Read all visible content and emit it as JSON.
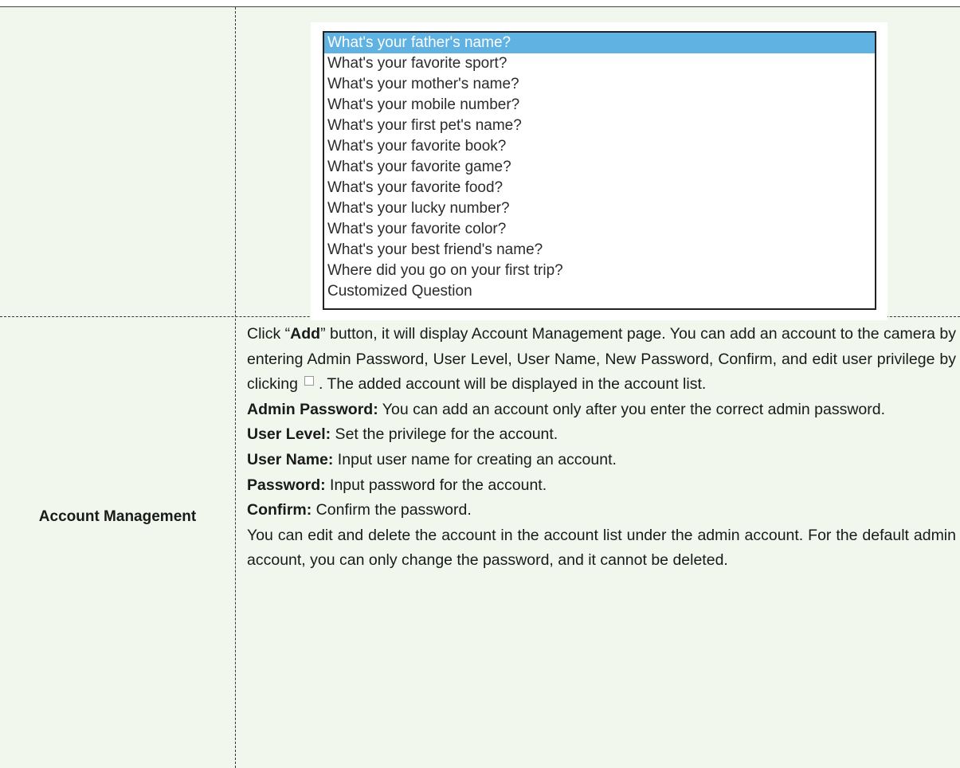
{
  "security_questions": {
    "options": [
      "What's your father's name?",
      "What's your favorite sport?",
      "What's your mother's name?",
      "What's your mobile number?",
      "What's your first pet's name?",
      "What's your favorite book?",
      "What's your favorite game?",
      "What's your favorite food?",
      "What's your lucky number?",
      "What's your favorite color?",
      "What's your best friend's name?",
      "Where did you go on your first trip?",
      "Customized Question"
    ],
    "selected": "What's your father's name?"
  },
  "account_management": {
    "label": "Account Management",
    "intro": {
      "before_add": "Click “",
      "add": "Add",
      "after_add": "” button, it will display Account Management page. You can add an account to the camera by entering Admin Password, User Level, User Name, New Password, Confirm, and edit user privilege by clicking",
      "after_icon": ". The added account will be displayed in the account list."
    },
    "fields": [
      {
        "term": "Admin Password:",
        "desc": " You can add an account only after you enter the correct admin password."
      },
      {
        "term": "User Level:",
        "desc": " Set the privilege for the account."
      },
      {
        "term": "User Name:",
        "desc": " Input user name for creating an account."
      },
      {
        "term": "Password:",
        "desc": " Input password for the account."
      },
      {
        "term": "Confirm:",
        "desc": " Confirm the password."
      }
    ],
    "footer": "You can edit and delete the account in the account list under the admin account. For the default admin account, you can only change the password, and it cannot be deleted."
  }
}
